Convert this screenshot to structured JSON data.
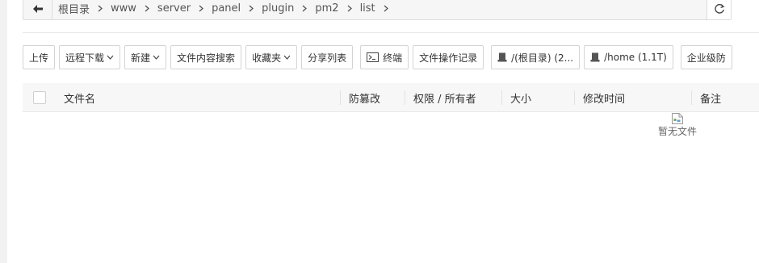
{
  "pathbar": {
    "crumbs": [
      "根目录",
      "www",
      "server",
      "panel",
      "plugin",
      "pm2",
      "list"
    ]
  },
  "toolbar": {
    "upload": "上传",
    "remote_download": "远程下载",
    "new": "新建",
    "content_search": "文件内容搜索",
    "favorites": "收藏夹",
    "share_list": "分享列表",
    "terminal": "终端",
    "operation_log": "文件操作记录",
    "disk_root": "/(根目录) (2...",
    "disk_home": "/home (1.1T)",
    "enterprise": "企业级防"
  },
  "table": {
    "headers": {
      "filename": "文件名",
      "tamper": "防篡改",
      "permission": "权限 / 所有者",
      "size": "大小",
      "mtime": "修改时间",
      "remark": "备注"
    }
  },
  "empty_state": {
    "text": "暂无文件",
    "icon": "broken-image-icon"
  }
}
